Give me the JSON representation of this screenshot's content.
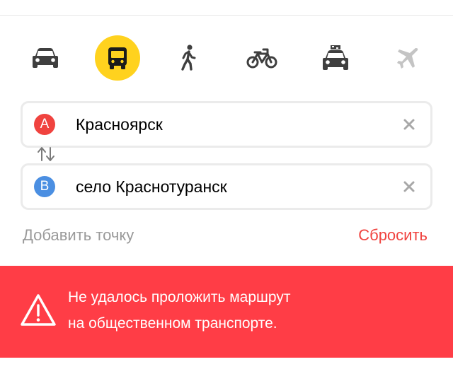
{
  "colors": {
    "active_mode_bg": "#ffd21e",
    "marker_a": "#f0433f",
    "marker_b": "#4b8fe2",
    "reset_text": "#f0433f",
    "error_banner": "#ff3d46",
    "muted_text": "#9a9a9a"
  },
  "transport_modes": [
    {
      "id": "car",
      "icon": "car-icon",
      "active": false
    },
    {
      "id": "public-transport",
      "icon": "bus-icon",
      "active": true
    },
    {
      "id": "walk",
      "icon": "pedestrian-icon",
      "active": false
    },
    {
      "id": "bicycle",
      "icon": "bicycle-icon",
      "active": false
    },
    {
      "id": "taxi",
      "icon": "taxi-icon",
      "active": false
    },
    {
      "id": "plane",
      "icon": "plane-icon",
      "active": false
    }
  ],
  "route": {
    "from": {
      "marker": "A",
      "value": "Красноярск"
    },
    "to": {
      "marker": "B",
      "value": "село Краснотуранск"
    }
  },
  "actions": {
    "add_point": "Добавить точку",
    "reset": "Сбросить"
  },
  "error": {
    "line1": "Не удалось проложить маршрут",
    "line2": "на общественном транспорте."
  }
}
